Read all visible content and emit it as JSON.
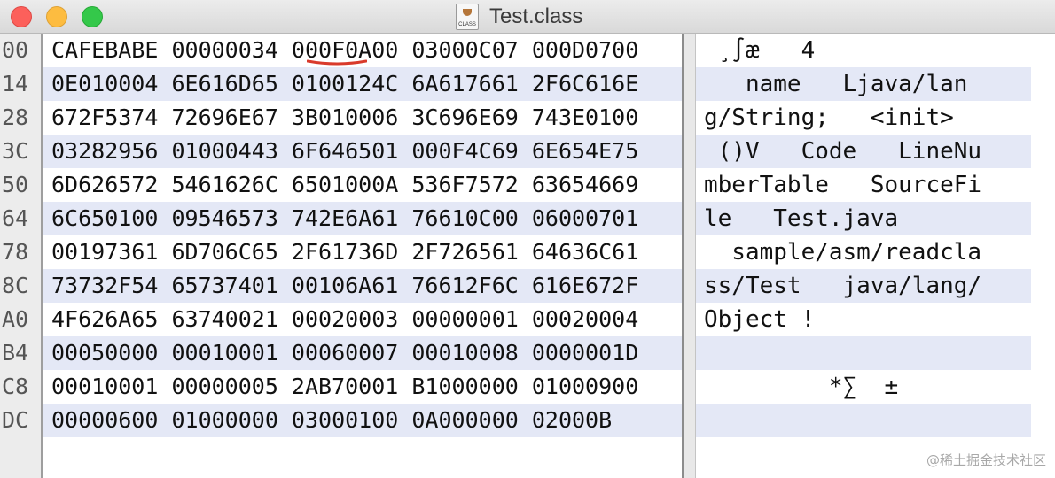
{
  "window": {
    "title": "Test.class",
    "file_icon_label": "CLASS"
  },
  "offsets": [
    "00",
    "14",
    "28",
    "3C",
    "50",
    "64",
    "78",
    "8C",
    "A0",
    "B4",
    "C8",
    "DC"
  ],
  "hex_rows": [
    "CAFEBABE 00000034 000F0A00 03000C07 000D0700",
    "0E010004 6E616D65 0100124C 6A617661 2F6C616E",
    "672F5374 72696E67 3B010006 3C696E69 743E0100",
    "03282956 01000443 6F646501 000F4C69 6E654E75",
    "6D626572 5461626C 6501000A 536F7572 63654669",
    "6C650100 09546573 742E6A61 76610C00 06000701",
    "00197361 6D706C65 2F61736D 2F726561 64636C61",
    "73732F54 65737401 00106A61 76612F6C 616E672F",
    "4F626A65 63740021 00020003 00000001 00020004",
    "00050000 00010001 00060007 00010008 0000001D",
    "00010001 00000005 2AB70001 B1000000 01000900",
    "00000600 01000000 03000100 0A000000 02000B"
  ],
  "ascii_rows": [
    " ¸∫æ   4",
    "   name   Ljava/lan",
    "g/String;   <init>",
    " ()V   Code   LineNu",
    "mberTable   SourceFi",
    "le   Test.java",
    "  sample/asm/readcla",
    "ss/Test   java/lang/",
    "Object !",
    "",
    "         *∑  ±",
    ""
  ],
  "watermark": "@稀土掘金技术社区",
  "colors": {
    "row_alt": "#e4e8f6",
    "underline": "#d93a2b"
  }
}
